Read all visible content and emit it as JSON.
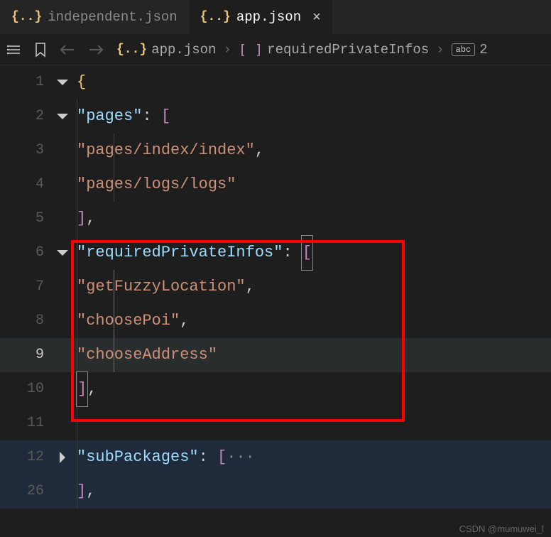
{
  "tabs": [
    {
      "label": "independent.json"
    },
    {
      "label": "app.json"
    }
  ],
  "breadcrumb": {
    "file": "app.json",
    "path1": "requiredPrivateInfos",
    "path2": "2"
  },
  "gutter": {
    "l1": "1",
    "l2": "2",
    "l3": "3",
    "l4": "4",
    "l5": "5",
    "l6": "6",
    "l7": "7",
    "l8": "8",
    "l9": "9",
    "l10": "10",
    "l11": "11",
    "l12": "12",
    "l26": "26"
  },
  "code": {
    "open_brace": "{",
    "pages_key": "\"pages\"",
    "colon_space": ": ",
    "open_bracket": "[",
    "page1": "\"pages/index/index\"",
    "page2": "\"pages/logs/logs\"",
    "close_bracket": "]",
    "comma": ",",
    "rpi_key": "\"requiredPrivateInfos\"",
    "rpi1": "\"getFuzzyLocation\"",
    "rpi2": "\"choosePoi\"",
    "rpi3": "\"chooseAddress\"",
    "sub_key": "\"subPackages\"",
    "ellipsis": "···"
  },
  "watermark": "CSDN @mumuwei_l"
}
